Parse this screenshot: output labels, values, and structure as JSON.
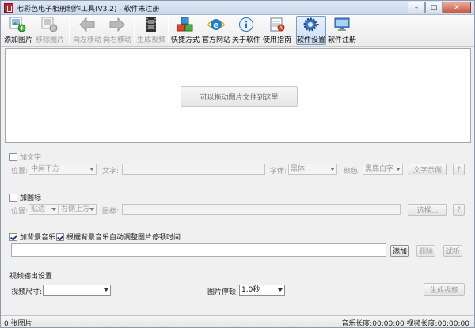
{
  "window": {
    "title": "七彩色电子相册制作工具(V3.2) - 软件未注册",
    "buttons": {
      "minimize": "–",
      "maximize": "□",
      "close": "✕"
    }
  },
  "toolbar": {
    "items": [
      {
        "label": "添加图片",
        "icon": "add-image-icon",
        "enabled": true
      },
      {
        "label": "移除图片",
        "icon": "remove-image-icon",
        "enabled": false
      },
      {
        "label": "向左移动",
        "icon": "arrow-left-icon",
        "enabled": false
      },
      {
        "label": "向右移动",
        "icon": "arrow-right-icon",
        "enabled": false
      },
      {
        "label": "生成视频",
        "icon": "film-icon",
        "enabled": false
      },
      {
        "label": "快捷方式",
        "icon": "cubes-icon",
        "enabled": true
      },
      {
        "label": "官方网站",
        "icon": "ie-icon",
        "enabled": true
      },
      {
        "label": "关于软件",
        "icon": "info-icon",
        "enabled": true
      },
      {
        "label": "使用指南",
        "icon": "guide-icon",
        "enabled": true
      },
      {
        "label": "软件设置",
        "icon": "gear-icon",
        "enabled": true,
        "active": true
      },
      {
        "label": "软件注册",
        "icon": "monitor-icon",
        "enabled": true
      }
    ]
  },
  "dropzone": {
    "hint": "可以拖动图片文件到这里"
  },
  "text_section": {
    "checkbox_label": "加文字",
    "checked": false,
    "position_label": "位置:",
    "position_value": "中间下方",
    "text_label": "文字:",
    "text_value": "",
    "font_label": "字体:",
    "font_value": "黑体",
    "color_label": "颜色:",
    "color_value": "黑底白字",
    "sample_button": "文字示例",
    "help_button": "?"
  },
  "icon_section": {
    "checkbox_label": "加图标",
    "checked": false,
    "position_label": "位置:",
    "position_mode": "贴边",
    "position_value": "右侧上方",
    "icon_label": "图标:",
    "icon_value": "",
    "choose_button": "选择...",
    "help_button": "?"
  },
  "music_section": {
    "checkbox_label": "加背景音乐",
    "checked": true,
    "auto_label": "根据背景音乐自动调整图片停顿时间",
    "auto_checked": true,
    "path_value": "",
    "add_button": "添加",
    "delete_button": "删除",
    "preview_button": "试听"
  },
  "output_section": {
    "heading": "视频输出设置",
    "size_label": "视频尺寸:",
    "size_value": "",
    "pause_label": "图片停顿:",
    "pause_value": "1.0秒",
    "generate_button": "生成视频"
  },
  "status": {
    "left": "0 张图片",
    "right": "音乐长度:00:00:00  视频长度:00:00:00"
  }
}
